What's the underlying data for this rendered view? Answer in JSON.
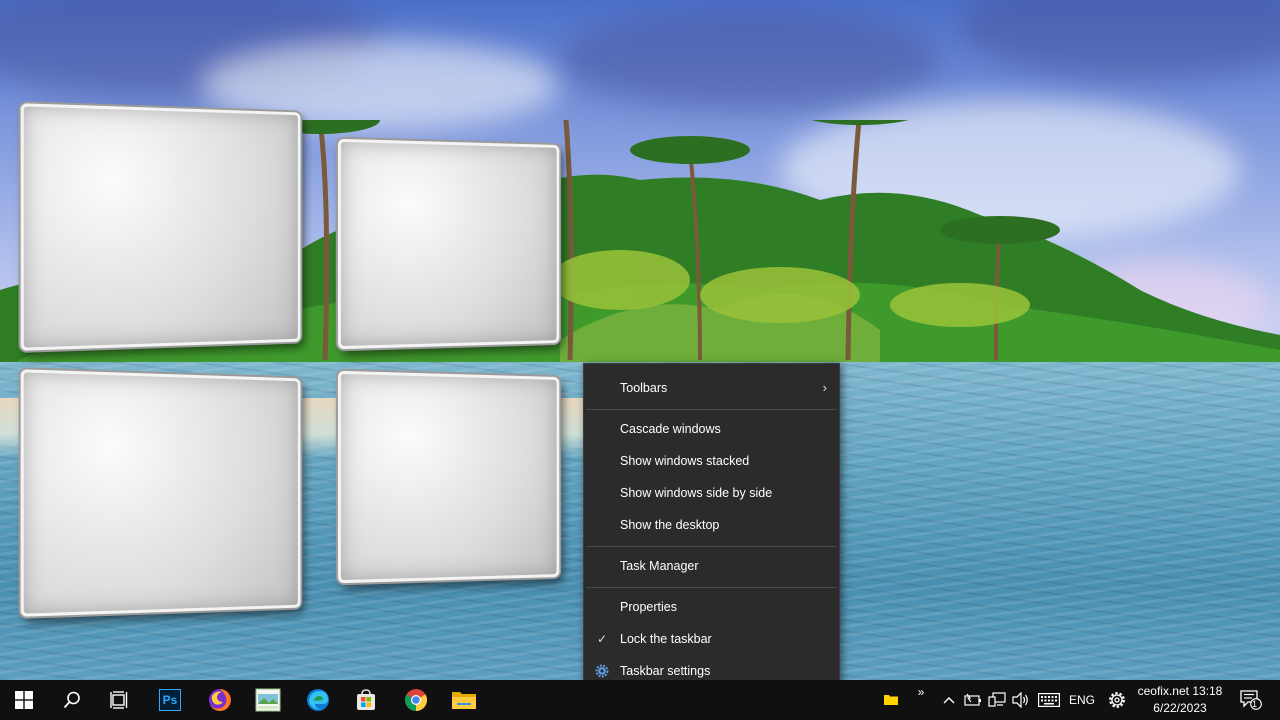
{
  "context_menu": {
    "items": [
      {
        "label": "Toolbars",
        "has_submenu": true
      },
      {
        "label": "Cascade windows"
      },
      {
        "label": "Show windows stacked"
      },
      {
        "label": "Show windows side by side"
      },
      {
        "label": "Show the desktop"
      },
      {
        "label": "Task Manager"
      },
      {
        "label": "Properties"
      },
      {
        "label": "Lock the taskbar",
        "checked": true
      },
      {
        "label": "Taskbar settings",
        "icon": "gear-icon"
      }
    ],
    "submenu_glyph": "›",
    "check_glyph": "✓"
  },
  "taskbar": {
    "pinned": [
      {
        "name": "start-button",
        "icon": "windows-logo-icon"
      },
      {
        "name": "search-button",
        "icon": "search-icon"
      },
      {
        "name": "task-view-button",
        "icon": "task-view-icon"
      },
      {
        "name": "photoshop-app",
        "icon": "photoshop-icon",
        "text": "Ps"
      },
      {
        "name": "firefox-app",
        "icon": "firefox-icon"
      },
      {
        "name": "photo-app",
        "icon": "image-app-icon"
      },
      {
        "name": "edge-app",
        "icon": "edge-icon"
      },
      {
        "name": "store-app",
        "icon": "microsoft-store-icon"
      },
      {
        "name": "chrome-app",
        "icon": "chrome-icon"
      },
      {
        "name": "file-explorer-app",
        "icon": "folder-icon"
      }
    ],
    "tray": {
      "toolbar_chevron": "»",
      "show_hidden_glyph": "^",
      "language": "ENG",
      "clock_line1": "ceofix.net 13:18",
      "clock_line2": "6/22/2023",
      "notification_count": "1"
    }
  },
  "colors": {
    "menu_bg": "#2b2b2b",
    "taskbar_bg": "#101010",
    "accent_gear": "#5fa0e8"
  }
}
